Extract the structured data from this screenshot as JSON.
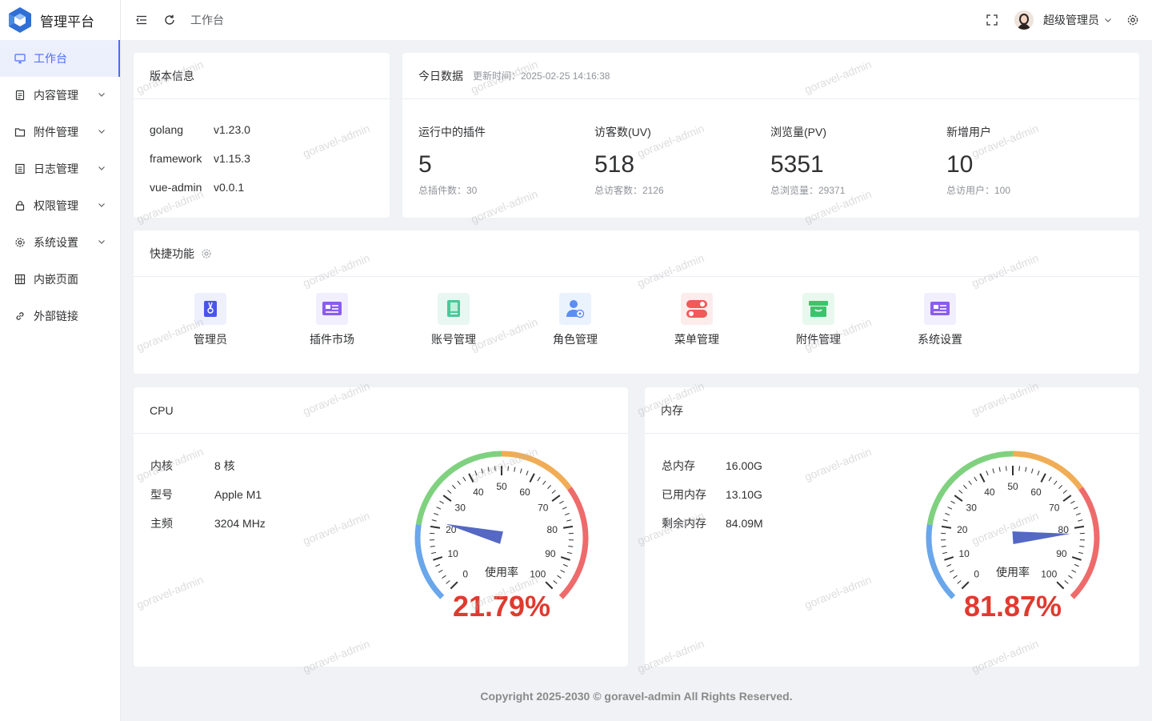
{
  "app": {
    "title": "管理平台"
  },
  "sidebar": {
    "items": [
      {
        "label": "工作台",
        "icon": "monitor-icon",
        "active": true
      },
      {
        "label": "内容管理",
        "icon": "document-icon",
        "expandable": true
      },
      {
        "label": "附件管理",
        "icon": "folder-icon",
        "expandable": true
      },
      {
        "label": "日志管理",
        "icon": "list-icon",
        "expandable": true
      },
      {
        "label": "权限管理",
        "icon": "lock-icon",
        "expandable": true
      },
      {
        "label": "系统设置",
        "icon": "gear-icon",
        "expandable": true
      },
      {
        "label": "内嵌页面",
        "icon": "grid-icon"
      },
      {
        "label": "外部链接",
        "icon": "link-icon"
      }
    ]
  },
  "header": {
    "breadcrumb": "工作台",
    "user": "超级管理员"
  },
  "version": {
    "title": "版本信息",
    "rows": [
      {
        "k": "golang",
        "v": "v1.23.0"
      },
      {
        "k": "framework",
        "v": "v1.15.3"
      },
      {
        "k": "vue-admin",
        "v": "v0.0.1"
      }
    ]
  },
  "today": {
    "title": "今日数据",
    "updated": "更新时间：2025-02-25 14:16:38",
    "stats": [
      {
        "label": "运行中的插件",
        "value": "5",
        "sub": "总插件数：30"
      },
      {
        "label": "访客数(UV)",
        "value": "518",
        "sub": "总访客数：2126"
      },
      {
        "label": "浏览量(PV)",
        "value": "5351",
        "sub": "总浏览量：29371"
      },
      {
        "label": "新增用户",
        "value": "10",
        "sub": "总访用户：100"
      }
    ]
  },
  "quick": {
    "title": "快捷功能",
    "items": [
      {
        "label": "管理员",
        "icon": "admin-icon",
        "bg": "#eef0fe",
        "fg": "#4a55e8"
      },
      {
        "label": "插件市场",
        "icon": "plugin-market-icon",
        "bg": "#f1eefe",
        "fg": "#8a5cf0"
      },
      {
        "label": "账号管理",
        "icon": "account-book-icon",
        "bg": "#e8f7f1",
        "fg": "#4cc79a"
      },
      {
        "label": "角色管理",
        "icon": "role-user-icon",
        "bg": "#eaf2fd",
        "fg": "#5b8ef0"
      },
      {
        "label": "菜单管理",
        "icon": "menu-toggle-icon",
        "bg": "#fdecec",
        "fg": "#ef5a5a"
      },
      {
        "label": "附件管理",
        "icon": "archive-icon",
        "bg": "#e8f8ee",
        "fg": "#3cc46c"
      },
      {
        "label": "系统设置",
        "icon": "system-card-icon",
        "bg": "#f1eefe",
        "fg": "#8a5cf0"
      }
    ]
  },
  "cpu": {
    "title": "CPU",
    "rows": [
      {
        "k": "内核",
        "v": "8 核"
      },
      {
        "k": "型号",
        "v": "Apple M1"
      },
      {
        "k": "主频",
        "v": "3204 MHz"
      }
    ],
    "gauge_label": "使用率",
    "usage": 21.79,
    "usage_text": "21.79%"
  },
  "memory": {
    "title": "内存",
    "rows": [
      {
        "k": "总内存",
        "v": "16.00G"
      },
      {
        "k": "已用内存",
        "v": "13.10G"
      },
      {
        "k": "剩余内存",
        "v": "84.09M"
      }
    ],
    "gauge_label": "使用率",
    "usage": 81.87,
    "usage_text": "81.87%"
  },
  "gauge_ticks": [
    "0",
    "10",
    "20",
    "30",
    "40",
    "50",
    "60",
    "70",
    "80",
    "90",
    "100"
  ],
  "colors": {
    "accent": "#4a6cf7",
    "gauge_low": "#6aa6ea",
    "gauge_mid": "#7fd17f",
    "gauge_warn": "#f0ad55",
    "gauge_high": "#ee6b6b",
    "percent": "#e03a2f",
    "needle": "#5468c4"
  },
  "watermark": "goravel-admin",
  "footer": "Copyright 2025-2030 © goravel-admin All Rights Reserved."
}
